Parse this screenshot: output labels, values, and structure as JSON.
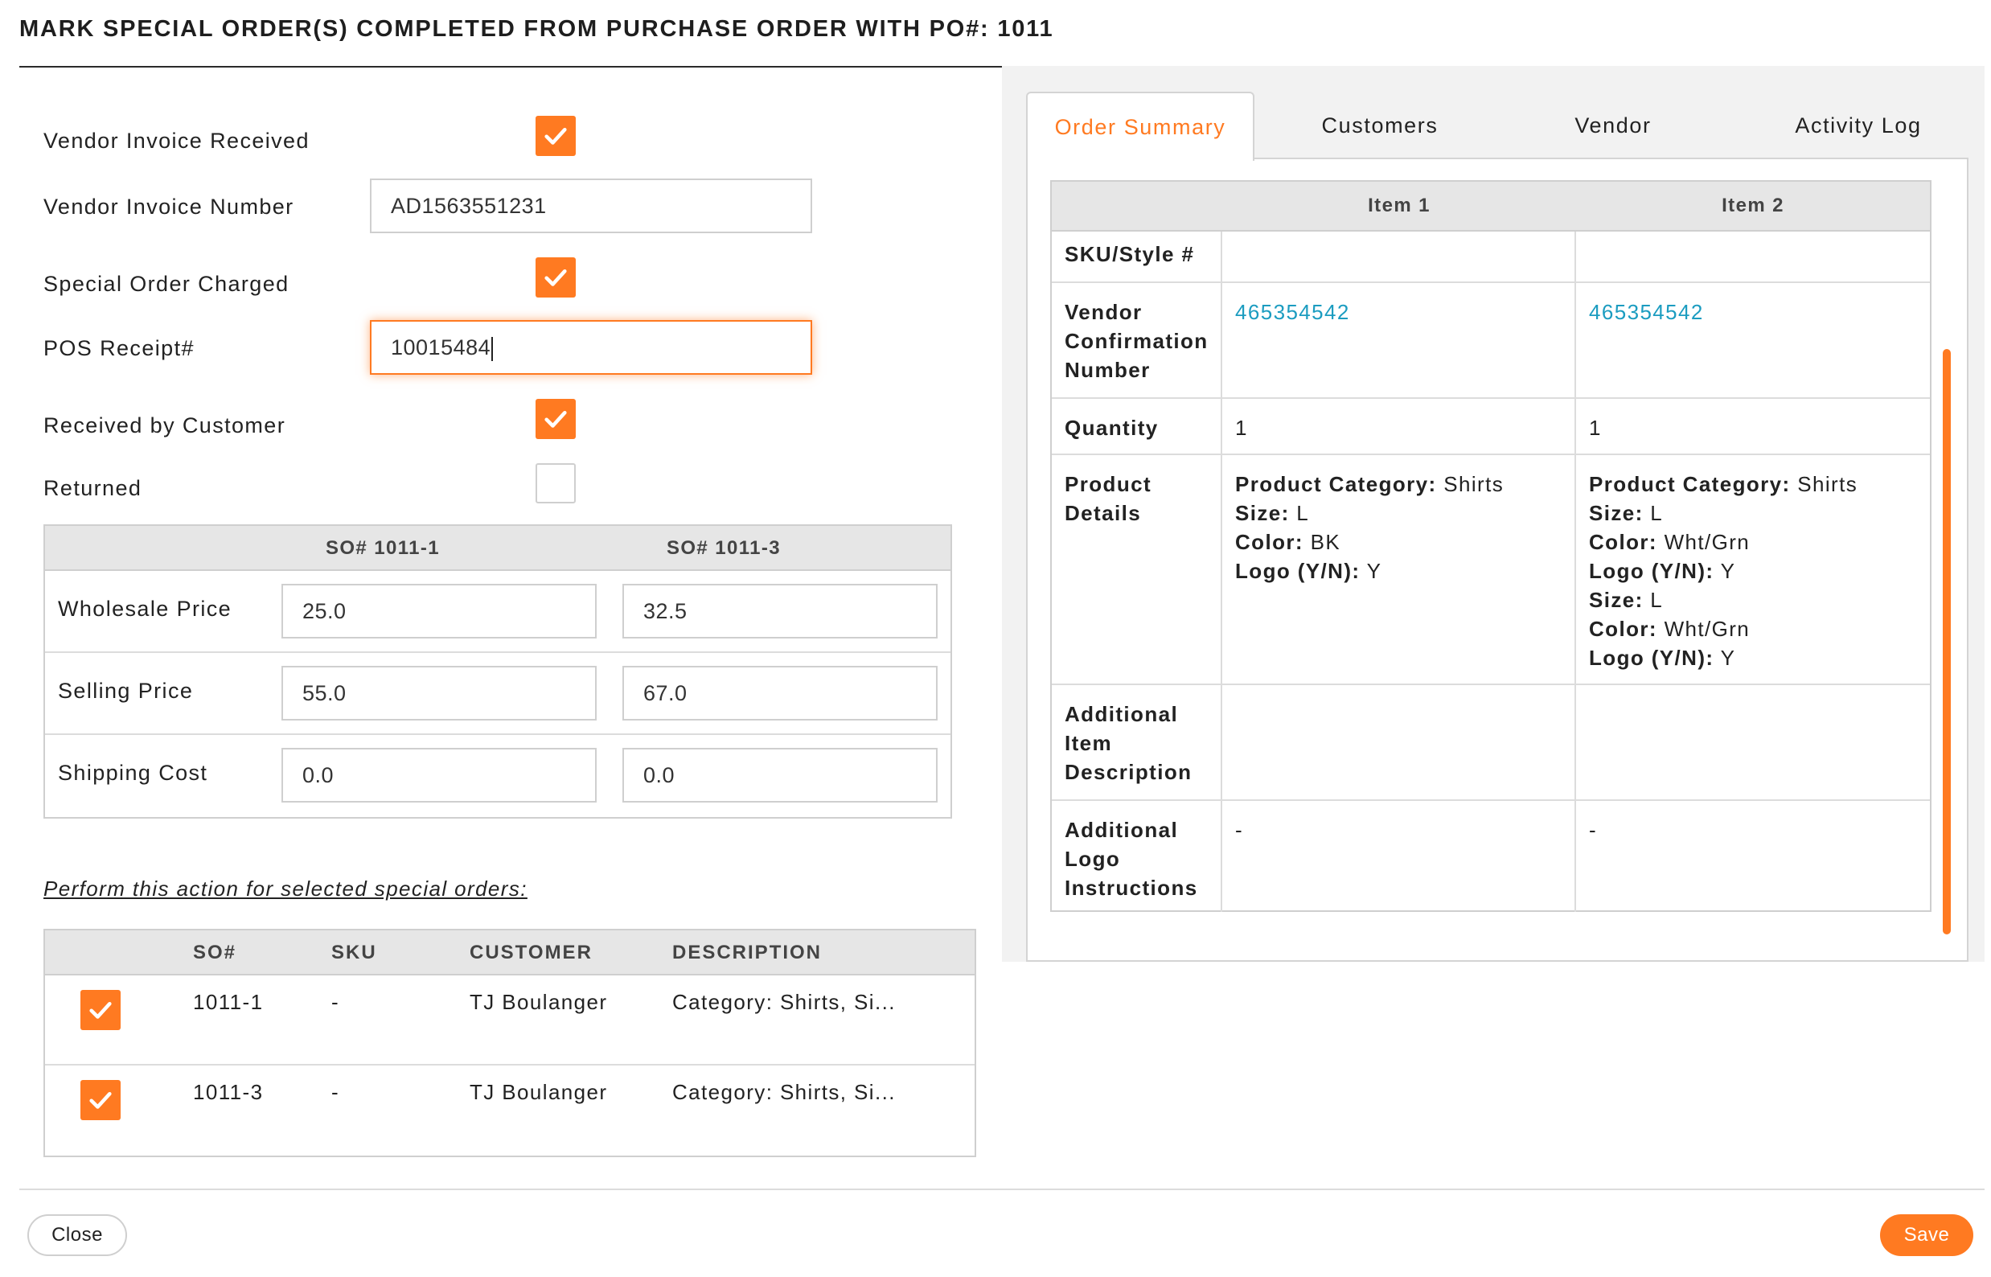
{
  "title": "MARK SPECIAL ORDER(S) COMPLETED FROM PURCHASE ORDER WITH PO#: 1011",
  "form": {
    "vendor_invoice_received_label": "Vendor Invoice Received",
    "vendor_invoice_received_checked": true,
    "vendor_invoice_number_label": "Vendor Invoice Number",
    "vendor_invoice_number_value": "AD1563551231",
    "special_order_charged_label": "Special Order Charged",
    "special_order_charged_checked": true,
    "pos_receipt_label": "POS Receipt#",
    "pos_receipt_value": "10015484",
    "received_by_customer_label": "Received by Customer",
    "received_by_customer_checked": true,
    "returned_label": "Returned",
    "returned_checked": false
  },
  "price_table": {
    "columns": [
      "SO# 1011-1",
      "SO# 1011-3"
    ],
    "rows": [
      {
        "label": "Wholesale Price",
        "values": [
          "25.0",
          "32.5"
        ]
      },
      {
        "label": "Selling Price",
        "values": [
          "55.0",
          "67.0"
        ]
      },
      {
        "label": "Shipping Cost",
        "values": [
          "0.0",
          "0.0"
        ]
      }
    ]
  },
  "action_note": "Perform this action for selected special orders:",
  "orders_table": {
    "columns": [
      "SO#",
      "SKU",
      "CUSTOMER",
      "DESCRIPTION"
    ],
    "rows": [
      {
        "checked": true,
        "so": "1011-1",
        "sku": "-",
        "customer": "TJ Boulanger",
        "description": "Category: Shirts, Si..."
      },
      {
        "checked": true,
        "so": "1011-3",
        "sku": "-",
        "customer": "TJ Boulanger",
        "description": "Category: Shirts, Si..."
      }
    ]
  },
  "tabs": [
    {
      "label": "Order Summary",
      "active": true
    },
    {
      "label": "Customers",
      "active": false
    },
    {
      "label": "Vendor",
      "active": false
    },
    {
      "label": "Activity Log",
      "active": false
    }
  ],
  "detail_table": {
    "columns": [
      "Item 1",
      "Item 2"
    ],
    "sku_label": "SKU/Style #",
    "vendor_conf_label": [
      "Vendor",
      "Confirmation",
      "Number"
    ],
    "vendor_conf_values": [
      "465354542",
      "465354542"
    ],
    "quantity_label": "Quantity",
    "quantity_values": [
      "1",
      "1"
    ],
    "product_details_label": [
      "Product",
      "Details"
    ],
    "item1_details": [
      {
        "k": "Product Category:",
        "v": " Shirts"
      },
      {
        "k": "Size:",
        "v": " L"
      },
      {
        "k": "Color:",
        "v": " BK"
      },
      {
        "k": "Logo (Y/N):",
        "v": " Y"
      }
    ],
    "item2_details": [
      {
        "k": "Product Category:",
        "v": " Shirts"
      },
      {
        "k": "Size:",
        "v": " L"
      },
      {
        "k": "Color:",
        "v": " Wht/Grn"
      },
      {
        "k": "Logo (Y/N):",
        "v": " Y"
      },
      {
        "k": "Size:",
        "v": " L"
      },
      {
        "k": "Color:",
        "v": " Wht/Grn"
      },
      {
        "k": "Logo (Y/N):",
        "v": " Y"
      }
    ],
    "additional_item_desc_label": [
      "Additional",
      "Item",
      "Description"
    ],
    "additional_logo_label": [
      "Additional",
      "Logo",
      "Instructions"
    ],
    "additional_logo_values": [
      "-",
      "-"
    ]
  },
  "footer": {
    "close_label": "Close",
    "save_label": "Save"
  },
  "colors": {
    "accent": "#ff7a21",
    "link": "#1b9cc0",
    "header_bg": "#e6e6e6"
  }
}
